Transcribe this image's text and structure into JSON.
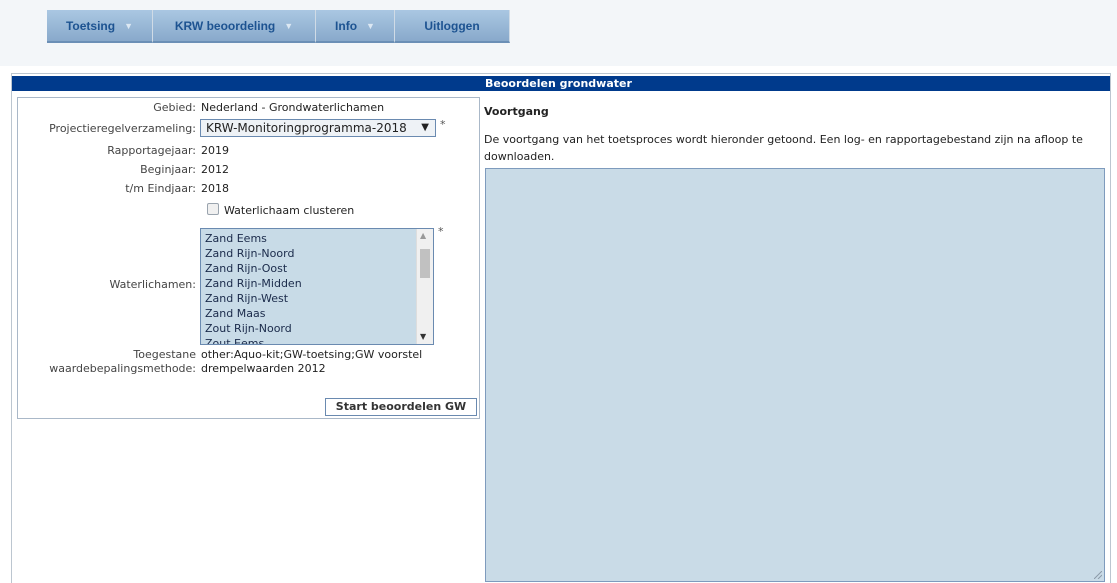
{
  "nav": [
    {
      "label": "Toetsing",
      "has_dropdown": true
    },
    {
      "label": "KRW beoordeling",
      "has_dropdown": true
    },
    {
      "label": "Info",
      "has_dropdown": true
    },
    {
      "label": "Uitloggen",
      "has_dropdown": false
    }
  ],
  "panel": {
    "title": "Beoordelen grondwater"
  },
  "form": {
    "gebied_label": "Gebied:",
    "gebied_value": "Nederland - Grondwaterlichamen",
    "project_label": "Projectieregelverzameling:",
    "project_value": "KRW-Monitoringprogramma-2018",
    "required_mark": "*",
    "rapport_label": "Rapportagejaar:",
    "rapport_value": "2019",
    "begin_label": "Beginjaar:",
    "begin_value": "2012",
    "eind_label": "t/m Eindjaar:",
    "eind_value": "2018",
    "cluster_label": "Waterlichaam clusteren",
    "cluster_checked": false,
    "waterlichamen_label": "Waterlichamen:",
    "waterlichamen": [
      "Zand Eems",
      "Zand Rijn-Noord",
      "Zand Rijn-Oost",
      "Zand Rijn-Midden",
      "Zand Rijn-West",
      "Zand Maas",
      "Zout Rijn-Noord",
      "Zout Eems"
    ],
    "methode_label_1": "Toegestane",
    "methode_label_2": "waardebepalingsmethode:",
    "methode_value_1": "other:Aquo-kit;GW-toetsing;GW voorstel",
    "methode_value_2": "drempelwaarden 2012",
    "start_button": "Start beoordelen GW"
  },
  "progress": {
    "title": "Voortgang",
    "description": "De voortgang van het toetsproces wordt hieronder getoond. Een log- en rapportagebestand zijn na afloop te downloaden.",
    "log_text": ""
  },
  "colors": {
    "header_bg": "#003a8c",
    "nav_text": "#1d5391",
    "log_bg": "#c9dbe7"
  }
}
